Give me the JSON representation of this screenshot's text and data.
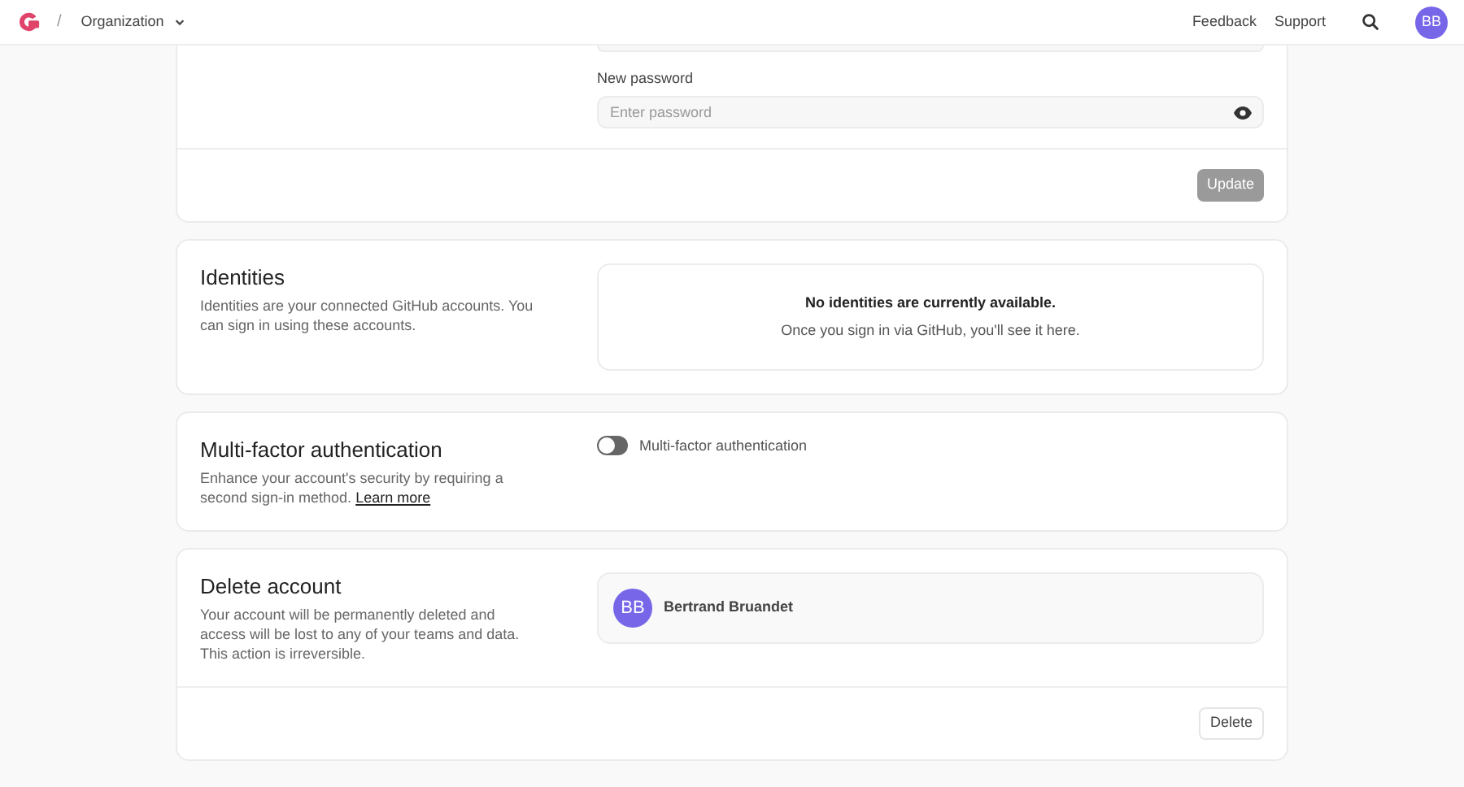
{
  "header": {
    "separator": "/",
    "org": "Organization",
    "links": [
      "Feedback",
      "Support"
    ],
    "avatar": "BB"
  },
  "password": {
    "label": "New password",
    "placeholder": "Enter password",
    "button": {
      "label": "Update",
      "disabled": true
    }
  },
  "identities": {
    "title": "Identities",
    "description": "Identities are your connected GitHub accounts. You can sign in using these accounts.",
    "empty_title": "No identities are currently available.",
    "empty_text": "Once you sign in via GitHub, you'll see it here."
  },
  "mfa": {
    "title": "Multi-factor authentication",
    "description": "Enhance your account's security by requiring a second sign-in method.",
    "link": "Learn more",
    "toggle_label": "Multi-factor authentication",
    "on": false
  },
  "delete": {
    "title": "Delete account",
    "description": "Your account will be permanently deleted and access will be lost to any of your teams and data. This action is irreversible.",
    "user": {
      "initials": "BB",
      "name": "Bertrand Bruandet"
    },
    "button": "Delete"
  }
}
